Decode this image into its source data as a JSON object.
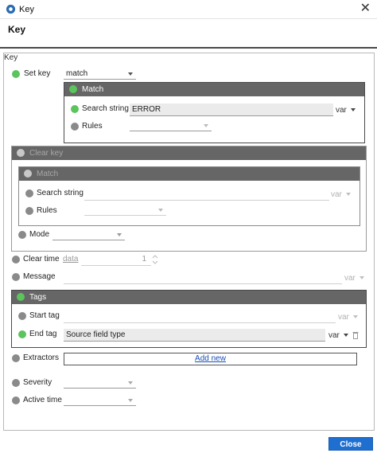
{
  "window": {
    "title": "Key",
    "close_glyph": "✕"
  },
  "header": {
    "title": "Key"
  },
  "section": {
    "label": "Key"
  },
  "set_key": {
    "label": "Set key",
    "mode_value": "match",
    "group_title": "Match",
    "search_label": "Search string",
    "search_value": "ERROR",
    "var_label": "var",
    "rules_label": "Rules"
  },
  "clear_key": {
    "group_title": "Clear key",
    "match_title": "Match",
    "search_label": "Search string",
    "var_label": "var",
    "rules_label": "Rules",
    "mode_label": "Mode"
  },
  "clear_time": {
    "label": "Clear time",
    "unit": "data",
    "value": "1"
  },
  "message": {
    "label": "Message",
    "var_label": "var"
  },
  "tags": {
    "group_title": "Tags",
    "start_label": "Start tag",
    "end_label": "End tag",
    "end_value": "Source field type",
    "var_label": "var"
  },
  "extractors": {
    "label": "Extractors",
    "add_label": "Add new"
  },
  "severity": {
    "label": "Severity"
  },
  "active_time": {
    "label": "Active time"
  },
  "footer": {
    "close_label": "Close"
  },
  "colors": {
    "accent": "#1f6fd1",
    "active_dot": "#5cc45c",
    "inactive_dot": "#8a8a8a",
    "group_header": "#666666"
  },
  "icons": {
    "app": "gear-icon",
    "delete": "trash-icon"
  }
}
